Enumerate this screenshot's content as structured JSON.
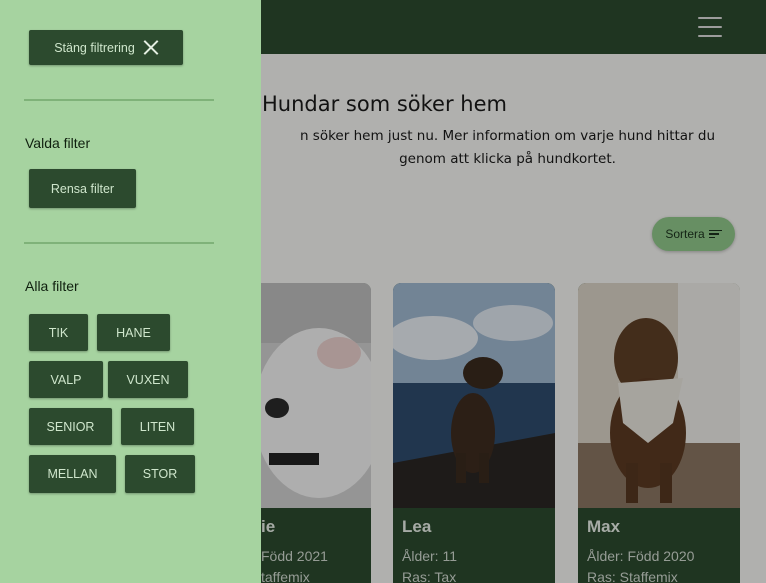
{
  "header": {
    "menu_icon": "hamburger-icon"
  },
  "main": {
    "title": "Hundar som söker hem",
    "intro_line1": "n söker hem just nu. Mer information om varje hund hittar du",
    "intro_line2": "genom att klicka på hundkortet.",
    "sort_label": "Sortera",
    "dogs": [
      {
        "name": "ie",
        "age": "Född 2021",
        "breed": "taffemix"
      },
      {
        "name": "Lea",
        "age": "Ålder: 11",
        "breed": "Ras: Tax"
      },
      {
        "name": "Max",
        "age": "Ålder: Född 2020",
        "breed": "Ras: Staffemix"
      }
    ]
  },
  "filter_panel": {
    "close_label": "Stäng filtrering",
    "selected_heading": "Valda filter",
    "clear_label": "Rensa filter",
    "all_heading": "Alla filter",
    "filters": [
      "TIK",
      "HANE",
      "VALP",
      "VUXEN",
      "SENIOR",
      "LITEN",
      "MELLAN",
      "STOR"
    ]
  },
  "colors": {
    "dark_green": "#2c4a2e",
    "panel_green": "#a6d3a0",
    "accent_green": "#8fc68a"
  }
}
